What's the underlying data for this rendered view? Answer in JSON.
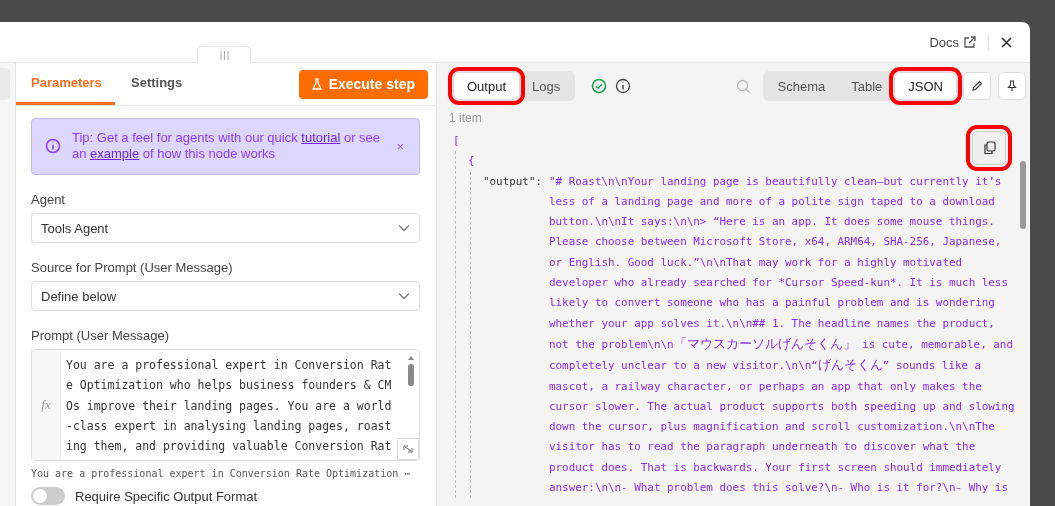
{
  "header": {
    "docs_link": "Docs"
  },
  "parameters_panel": {
    "tabs": [
      {
        "label": "Parameters",
        "selected": true
      },
      {
        "label": "Settings",
        "selected": false
      }
    ],
    "execute_button": "Execute step",
    "tip": {
      "parts": [
        {
          "kind": "text",
          "text": "Tip: Get a feel for agents with our quick "
        },
        {
          "kind": "link",
          "text": "tutorial"
        },
        {
          "kind": "text",
          "text": " or see an "
        },
        {
          "kind": "link",
          "text": "example"
        },
        {
          "kind": "text",
          "text": " of how this node works"
        }
      ],
      "dismiss": "×"
    },
    "fields": [
      {
        "kind": "select",
        "label": "Agent",
        "value": "Tools Agent"
      },
      {
        "kind": "select",
        "label": "Source for Prompt (User Message)",
        "value": "Define below"
      },
      {
        "kind": "expression",
        "label": "Prompt (User Message)",
        "badge": "fx",
        "value": "You are a professional expert in Conversion Rate Optimization who helps business founders & CMOs improve their landing pages. You are a world-class expert in analysing landing pages, roasting them, and providing valuable Conversion Rat",
        "preview": "You are a professional expert in Conversion Rate Optimization ⋯"
      }
    ],
    "toggle": {
      "label": "Require Specific Output Format",
      "on": false
    }
  },
  "output_panel": {
    "tabs": [
      {
        "label": "Output",
        "selected": true,
        "highlighted": true
      },
      {
        "label": "Logs",
        "selected": false,
        "highlighted": false
      }
    ],
    "view_modes": [
      {
        "label": "Schema",
        "selected": false,
        "highlighted": false
      },
      {
        "label": "Table",
        "selected": false,
        "highlighted": false
      },
      {
        "label": "JSON",
        "selected": true,
        "highlighted": true
      }
    ],
    "item_count": "1 item",
    "copy_button": {
      "highlighted": true
    },
    "json": {
      "open_bracket": "[",
      "open_brace": "{",
      "key": "\"output\":",
      "value": "\"# Roast\\n\\nYour landing page is beautifully clean—but currently it’s less of a landing page and more of a polite sign taped to a download button.\\n\\nIt says:\\n\\n> “Here is an app. It does some mouse things. Please choose between Microsoft Store, x64, ARM64, SHA-256, Japanese, or English. Good luck.”\\n\\nThat may work for a highly motivated developer who already searched for *Cursor Speed-kun*. It is much less likely to convert someone who has a painful problem and is wondering whether your app solves it.\\n\\n## 1. The headline names the product, not the problem\\n\\n「マウスカーソルげんそくん」 is cute, memorable, and completely unclear to a new visitor.\\n\\n“げんそくん” sounds like a mascot, a railway character, or perhaps an app that only makes the cursor slower. The actual product supports both speeding up and slowing down the cursor, plus magnification and scroll customization.\\n\\nThe visitor has to read the paragraph underneath to discover what the product does. That is backwards. Your first screen should immediately answer:\\n\\n- What problem does this solve?\\n- Who is it for?\\n- Why is"
    }
  }
}
